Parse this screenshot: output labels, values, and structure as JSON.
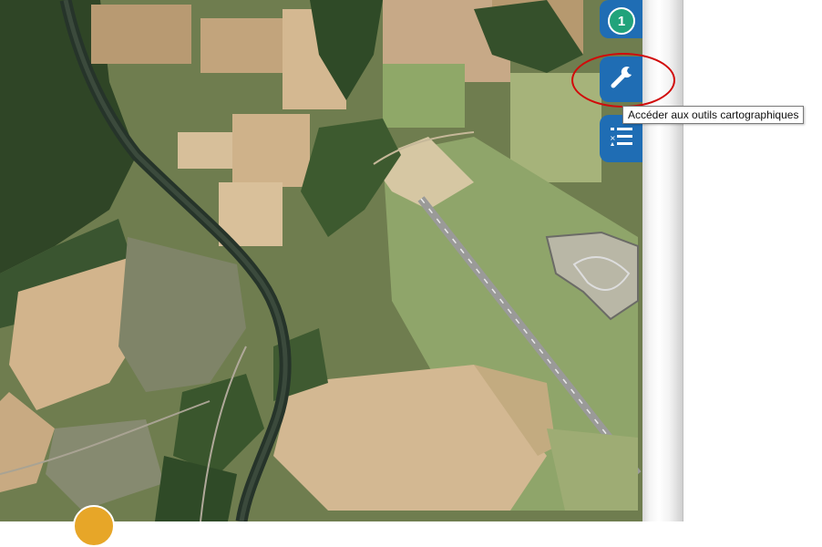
{
  "map": {
    "type": "satellite-aerial-view"
  },
  "toolbar": {
    "layers_badge_count": "1",
    "tools_icon": "wrench-icon",
    "legend_icon": "list-icon",
    "tools_tooltip": "Accéder aux outils cartographiques"
  },
  "colors": {
    "toolbar_blue": "#1f6db4",
    "badge_green": "#21a37b",
    "highlight_red": "#d10a0a",
    "locate_orange": "#e7a628"
  }
}
